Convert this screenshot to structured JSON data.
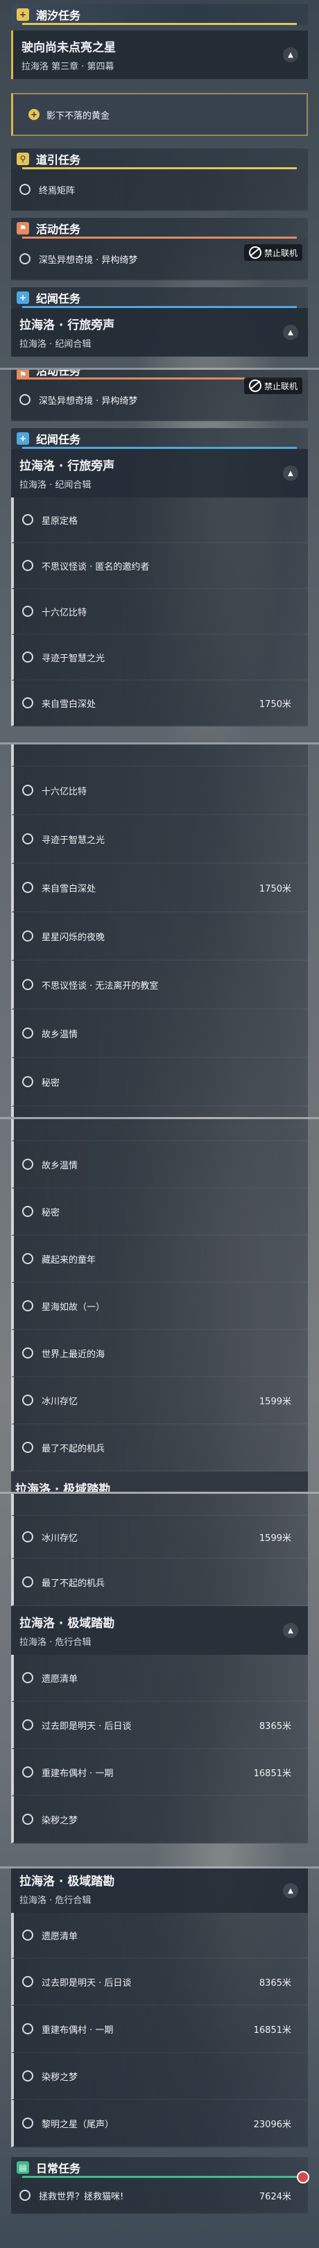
{
  "sections": {
    "chao_xi": "潮汐任务",
    "dao_yin": "道引任务",
    "huo_dong": "活动任务",
    "ji_wen": "纪闻任务",
    "ri_chang": "日常任务"
  },
  "main_quest": {
    "title": "驶向尚未点亮之星",
    "subtitle": "拉海洛 第三章 · 第四幕"
  },
  "tracked_step": "影下不落的黄金",
  "guide_quest": "终焉矩阵",
  "event_quest": "深坠异想奇境 · 异构绮梦",
  "lock_label": "禁止联机",
  "chronicle_1": {
    "title": "拉海洛 · 行旅旁声",
    "subtitle": "拉海洛 · 纪闻合辑"
  },
  "chronicle_2": {
    "title": "拉海洛 · 极域踏勘",
    "subtitle": "拉海洛 · 危行合辑"
  },
  "items": {
    "a1": "星原定格",
    "a2": "不思议怪谈 · 匿名的邀约者",
    "a3": "十六亿比特",
    "a4": "寻迹于智慧之光",
    "a5": "来自雪白深处",
    "a5d": "1750米",
    "a6": "星星闪烁的夜晚",
    "a7": "不思议怪谈 · 无法离开的教室",
    "a8": "故乡温情",
    "a9": "秘密",
    "a10": "藏起来的童年",
    "a11": "星海如故（一）",
    "a12": "世界上最近的海",
    "a13": "冰川存忆",
    "a13d": "1599米",
    "a14": "最了不起的机兵",
    "b1": "遗愿清单",
    "b2": "过去即是明天 · 后日谈",
    "b2d": "8365米",
    "b3": "重建布偶村 · 一期",
    "b3d": "16851米",
    "b4": "染秽之梦",
    "b5": "黎明之星（尾声）",
    "b5d": "23096米",
    "daily": "拯救世界？拯救猫咪!",
    "daily_d": "7624米"
  },
  "colors": {
    "main": "#e6c45a",
    "event": "#e48a5f",
    "chronicle": "#4fa7e2",
    "daily": "#46b98c"
  },
  "icons": {
    "main": "plus-icon",
    "guide": "location-pin-icon",
    "event": "flag-icon",
    "chronicle": "plus-icon",
    "daily": "book-icon",
    "lock": "no-multiplayer-icon",
    "expand": "chevron-up-icon"
  }
}
